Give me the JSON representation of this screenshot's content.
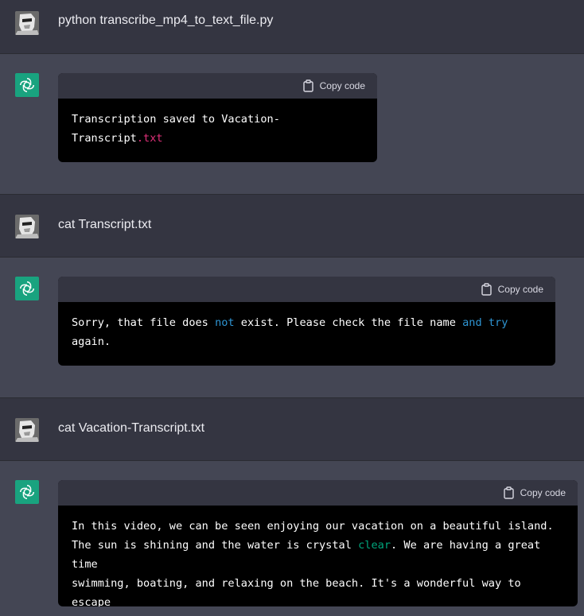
{
  "turns": [
    {
      "role": "user",
      "text": "python transcribe_mp4_to_text_file.py"
    },
    {
      "role": "assistant",
      "copy_label": "Copy code",
      "code": {
        "t1": "Transcription saved to Vacation-\nTranscript",
        "t2": ".txt"
      }
    },
    {
      "role": "user",
      "text": "cat Transcript.txt"
    },
    {
      "role": "assistant",
      "copy_label": "Copy code",
      "code": {
        "t1": "Sorry, that file does ",
        "t2": "not",
        "t3": " exist. Please check the file name ",
        "t4": "and",
        "t5": " ",
        "t6": "try",
        "t7": "\nagain."
      }
    },
    {
      "role": "user",
      "text": "cat Vacation-Transcript.txt"
    },
    {
      "role": "assistant",
      "copy_label": "Copy code",
      "code": {
        "t1": "In this video, we can be seen enjoying our vacation on a beautiful island.\nThe sun is shining and the water is crystal ",
        "t2": "clear",
        "t3": ". We are having a great time\nswimming, boating, and relaxing on the beach. It's a wonderful way to escape\nthe stress of everyday life."
      }
    }
  ],
  "colors": {
    "user_bg": "#343541",
    "assistant_bg": "#444654",
    "code_bg": "#000000",
    "bot_avatar": "#19a37f",
    "token_red": "#df3079",
    "token_blue": "#2e95d3",
    "token_green": "#00a67d"
  },
  "icons": {
    "user_avatar": "user-avatar-icon",
    "bot_avatar": "openai-logo-icon",
    "copy": "clipboard-icon"
  }
}
